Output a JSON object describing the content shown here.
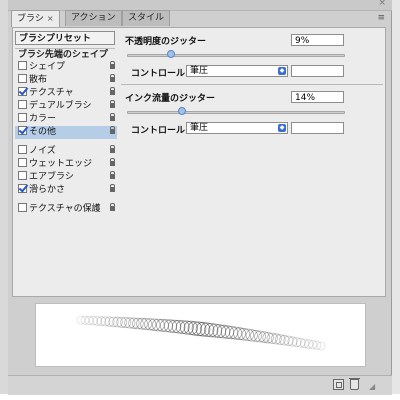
{
  "tabs": [
    {
      "label": "ブラシ",
      "close": "×",
      "active": true
    },
    {
      "label": "アクション",
      "active": false
    },
    {
      "label": "スタイル",
      "active": false
    }
  ],
  "panel": {
    "close_glyph": "×",
    "menu_glyph": "≡"
  },
  "left": {
    "preset_button": "ブラシプリセット",
    "section_header": "ブラシ先端のシェイプ",
    "options": [
      {
        "label": "シェイプ",
        "checked": false,
        "locked": true
      },
      {
        "label": "散布",
        "checked": false,
        "locked": true
      },
      {
        "label": "テクスチャ",
        "checked": true,
        "locked": true
      },
      {
        "label": "デュアルブラシ",
        "checked": false,
        "locked": true
      },
      {
        "label": "カラー",
        "checked": false,
        "locked": true
      },
      {
        "label": "その他",
        "checked": true,
        "locked": true,
        "selected": true
      },
      {
        "label": "ノイズ",
        "checked": false,
        "locked": true
      },
      {
        "label": "ウェットエッジ",
        "checked": false,
        "locked": true
      },
      {
        "label": "エアブラシ",
        "checked": false,
        "locked": true
      },
      {
        "label": "滑らかさ",
        "checked": true,
        "locked": true
      },
      {
        "label": "テクスチャの保護",
        "checked": false,
        "locked": true
      }
    ]
  },
  "right": {
    "opacity_jitter": {
      "label": "不透明度のジッター",
      "value": "9%",
      "slider_fraction": 0.09,
      "control_label": "コントロール：",
      "control_value": "筆圧"
    },
    "flow_jitter": {
      "label": "インク流量のジッター",
      "value": "14%",
      "slider_fraction": 0.14,
      "control_label": "コントロール：",
      "control_value": "筆圧"
    }
  },
  "colors": {
    "panel_bg": "#cfcfcf",
    "content_bg": "#ececec",
    "selection": "#b5cde6",
    "checkmark": "#2858c8",
    "slider_thumb": "#9fc1ea"
  },
  "icons": {
    "lock": "lock-icon",
    "new_brush": "new-brush-icon",
    "trash": "trash-icon",
    "resize": "resize-grip-icon"
  }
}
